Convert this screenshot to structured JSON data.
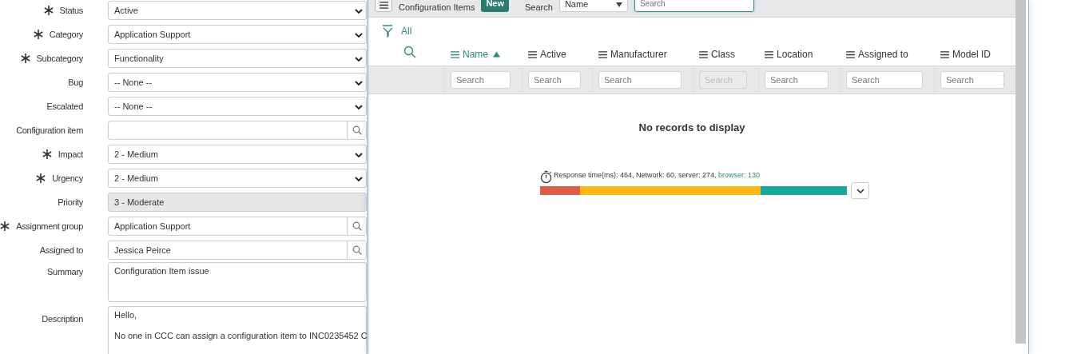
{
  "form": {
    "fields": [
      {
        "label": "Status",
        "required": true,
        "kind": "select",
        "value": "Active"
      },
      {
        "label": "Category",
        "required": true,
        "kind": "select",
        "value": "Application Support"
      },
      {
        "label": "Subcategory",
        "required": true,
        "kind": "select",
        "value": "Functionality"
      },
      {
        "label": "Bug",
        "required": false,
        "kind": "select",
        "value": "-- None --"
      },
      {
        "label": "Escalated",
        "required": false,
        "kind": "select",
        "value": "-- None --"
      },
      {
        "label": "Configuration item",
        "required": false,
        "kind": "lookup"
      },
      {
        "label": "Impact",
        "required": true,
        "kind": "select",
        "value": "2 - Medium"
      },
      {
        "label": "Urgency",
        "required": true,
        "kind": "select",
        "value": "2 - Medium"
      },
      {
        "label": "Priority",
        "required": false,
        "kind": "readonly",
        "value": "3 - Moderate"
      },
      {
        "label": "Assignment group",
        "required": true,
        "kind": "lookup",
        "value": "Application Support"
      },
      {
        "label": "Assigned to",
        "required": false,
        "kind": "lookup",
        "value": "Jessica Peirce"
      },
      {
        "label": "Summary",
        "required": false,
        "kind": "textarea",
        "value": "Configuration Item issue"
      },
      {
        "label": "Description",
        "required": false,
        "kind": "description",
        "lines": [
          "Hello,",
          "No one in CCC can assign a configuration item to INC0235452 C"
        ]
      }
    ]
  },
  "modal": {
    "title": "Configuration Items",
    "new_button": "New",
    "search_label": "Search",
    "search_field": "Name",
    "search_placeholder": "Search",
    "filter": "All",
    "columns": [
      {
        "label": "Name",
        "sorted": true,
        "placeholder": "Search",
        "disabled": false
      },
      {
        "label": "Active",
        "sorted": false,
        "placeholder": "Search",
        "disabled": false
      },
      {
        "label": "Manufacturer",
        "sorted": false,
        "placeholder": "Search",
        "disabled": false
      },
      {
        "label": "Class",
        "sorted": false,
        "placeholder": "Search",
        "disabled": true
      },
      {
        "label": "Location",
        "sorted": false,
        "placeholder": "Search",
        "disabled": false
      },
      {
        "label": "Assigned to",
        "sorted": false,
        "placeholder": "Search",
        "disabled": false
      },
      {
        "label": "Model ID",
        "sorted": false,
        "placeholder": "Search",
        "disabled": false
      }
    ],
    "empty_message": "No records to display",
    "response": {
      "text": "Response time(ms): 464, Network: 60, server: 274, ",
      "browser": "browser: 130",
      "segments": [
        {
          "color": "#e05a47"
        },
        {
          "color": "#fcb813"
        },
        {
          "color": "#18a99e"
        }
      ]
    }
  }
}
